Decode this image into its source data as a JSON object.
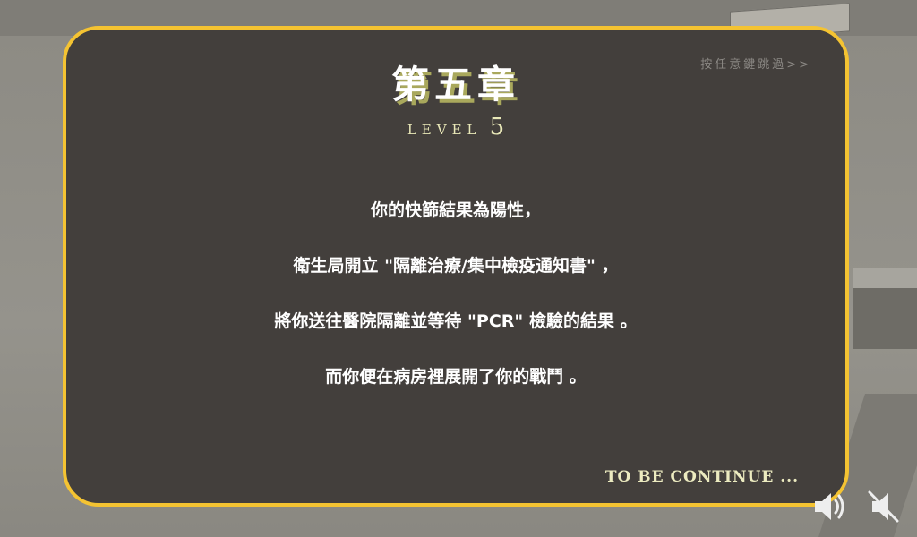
{
  "skip_hint": "按任意鍵跳過>>",
  "chapter": {
    "title": "第五章",
    "level_label": "LEVEL",
    "level_number": "5"
  },
  "story_lines": [
    "你的快篩結果為陽性，",
    "衛生局開立 \"隔離治療/集中檢疫通知書\" ，",
    "將你送往醫院隔離並等待 \"PCR\" 檢驗的結果 。",
    "而你便在病房裡展開了你的戰鬥 。"
  ],
  "footer": {
    "continue_text": "TO BE CONTINUE ..."
  },
  "controls": {
    "sound_on_icon": "speaker-on-icon",
    "sound_off_icon": "speaker-muted-icon"
  },
  "colors": {
    "frame_border": "#f4c332",
    "card_background": "#433f3c",
    "title_shadow": "#a9a85c",
    "accent_text": "#ecebc0"
  }
}
